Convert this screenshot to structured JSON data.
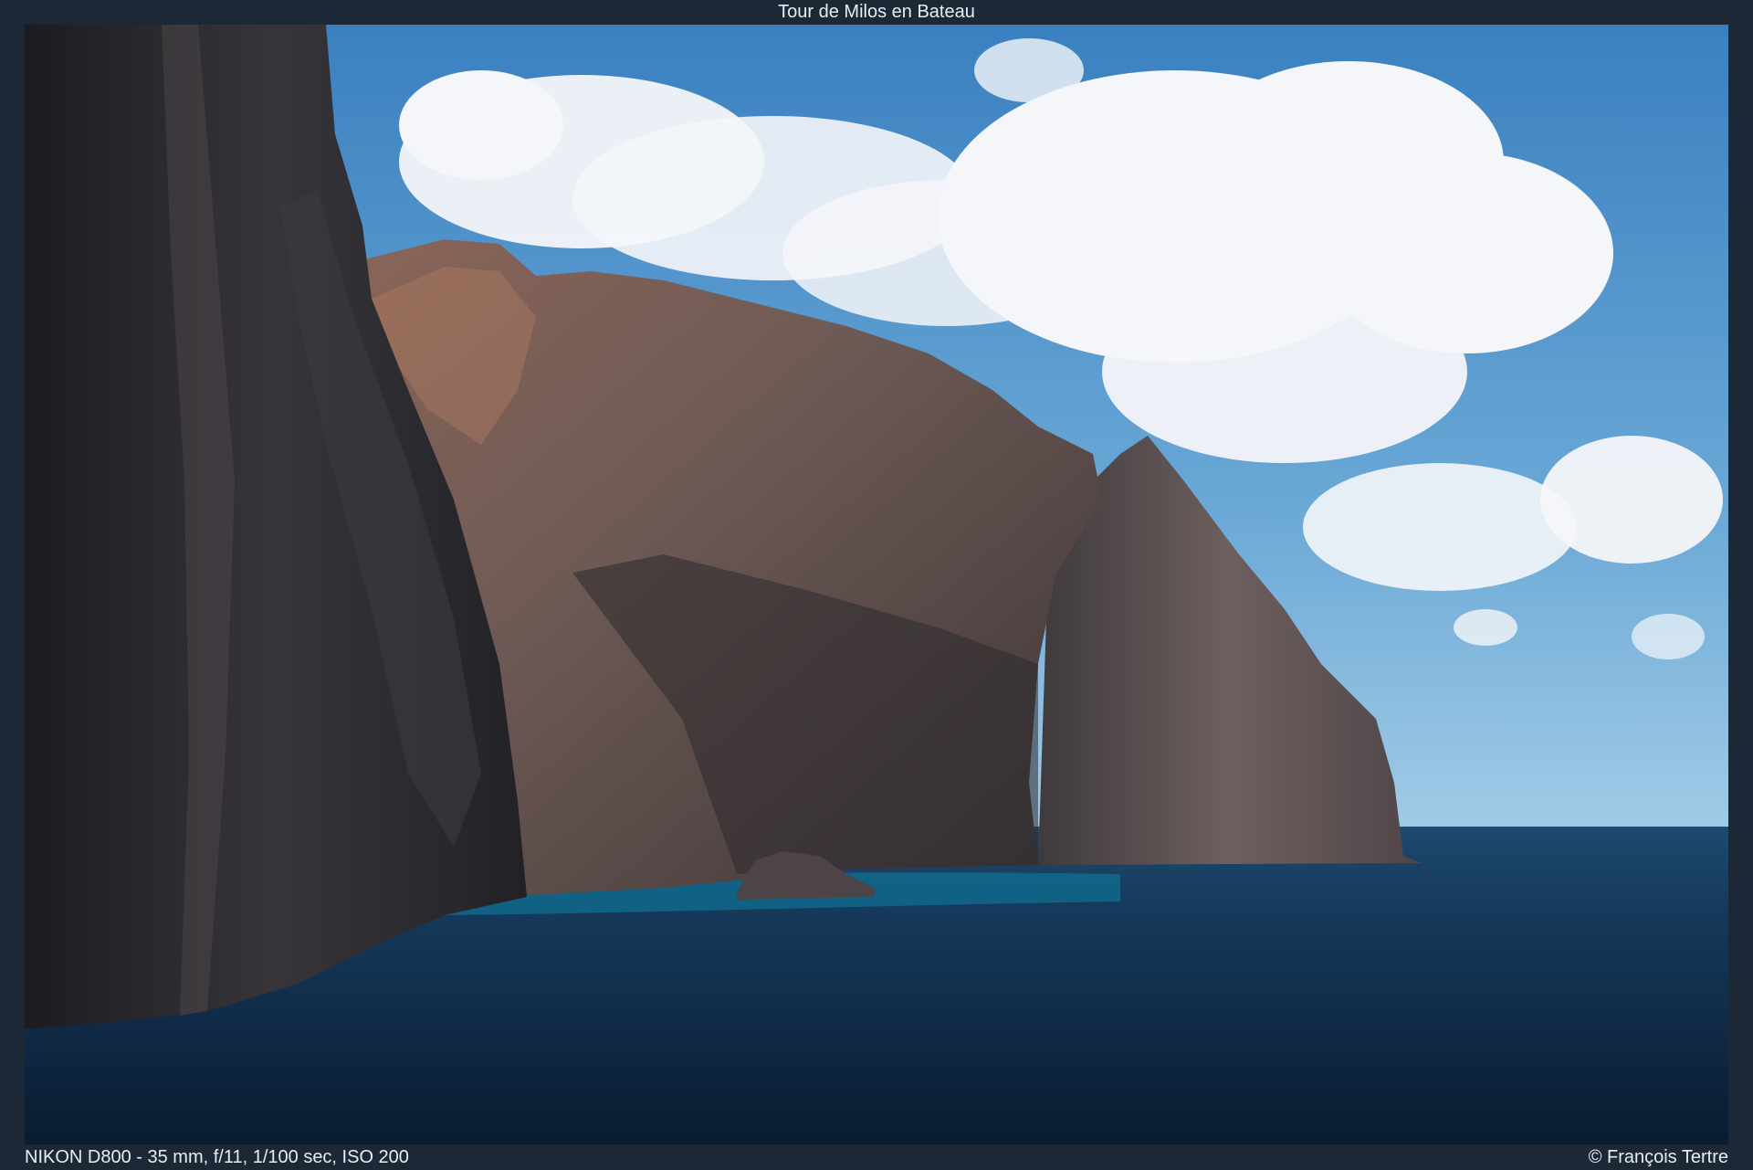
{
  "title": "Tour de Milos en Bateau",
  "caption": {
    "exif": "NIKON D800 - 35 mm, f/11, 1/100 sec, ISO 200",
    "copyright": "© François Tertre"
  },
  "colors": {
    "frame": "#1c2836",
    "sky_top": "#3f86c4",
    "sky_bottom": "#8fc2e2",
    "sea_dark": "#0f2238",
    "sea_teal": "#0e6d8f",
    "cliff_dark": "#2a2a2d",
    "cliff_rock": "#6b5450"
  }
}
